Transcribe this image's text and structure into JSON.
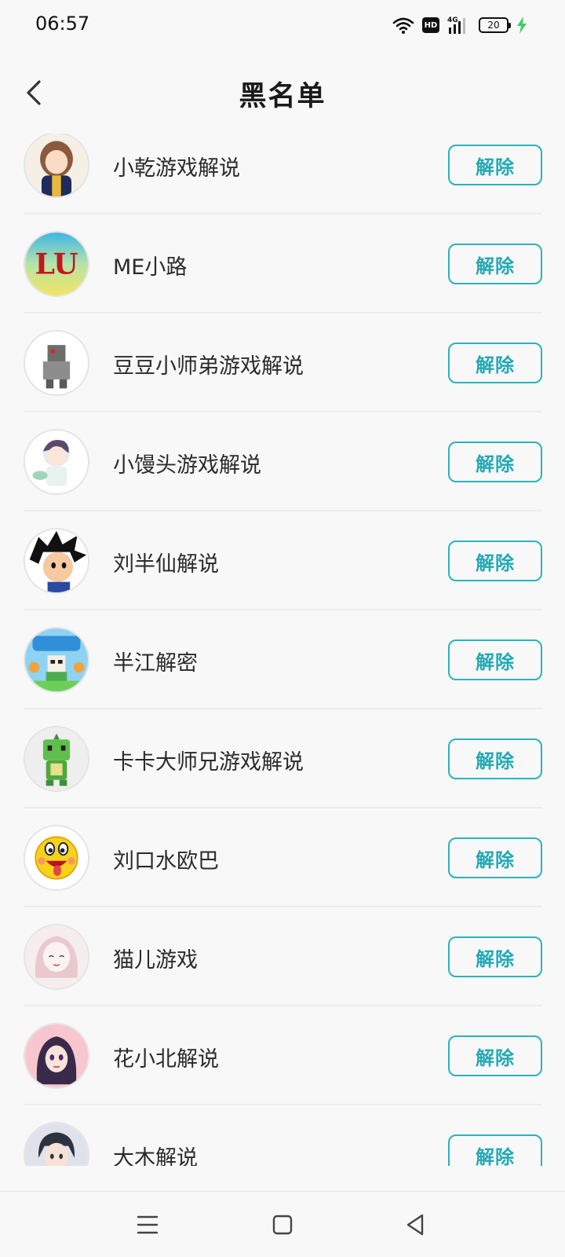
{
  "status_bar": {
    "time": "06:57",
    "network": "4G",
    "hd": "HD",
    "battery": "20",
    "icons": [
      "wifi-icon",
      "hd-icon",
      "signal-4g-icon",
      "battery-icon",
      "charging-bolt-icon"
    ]
  },
  "header": {
    "title": "黑名单",
    "back_icon": "chevron-left-icon"
  },
  "colors": {
    "accent": "#22a9b4",
    "background": "#f8f8f8",
    "divider": "#ececec",
    "charging": "#3ccf68"
  },
  "blocklist": [
    {
      "name": "小乾游戏解说",
      "action": "解除",
      "avatar": "anime-girl-avatar"
    },
    {
      "name": "ME小路",
      "action": "解除",
      "avatar": "lu-text-avatar",
      "avatar_text": "LU"
    },
    {
      "name": "豆豆小师弟游戏解说",
      "action": "解除",
      "avatar": "robot-avatar"
    },
    {
      "name": "小馒头游戏解说",
      "action": "解除",
      "avatar": "anime-boy-avatar"
    },
    {
      "name": "刘半仙解说",
      "action": "解除",
      "avatar": "goku-avatar"
    },
    {
      "name": "半江解密",
      "action": "解除",
      "avatar": "game-poster-avatar"
    },
    {
      "name": "卡卡大师兄游戏解说",
      "action": "解除",
      "avatar": "green-dino-avatar"
    },
    {
      "name": "刘口水欧巴",
      "action": "解除",
      "avatar": "emoji-face-avatar"
    },
    {
      "name": "猫儿游戏",
      "action": "解除",
      "avatar": "sketch-girl-avatar"
    },
    {
      "name": "花小北解说",
      "action": "解除",
      "avatar": "dark-hair-girl-avatar"
    },
    {
      "name": "大木解说",
      "action": "解除",
      "avatar": "anime-boy-dark-avatar"
    }
  ],
  "nav_bar": {
    "icons": [
      "menu-icon",
      "home-square-icon",
      "back-triangle-icon"
    ]
  }
}
